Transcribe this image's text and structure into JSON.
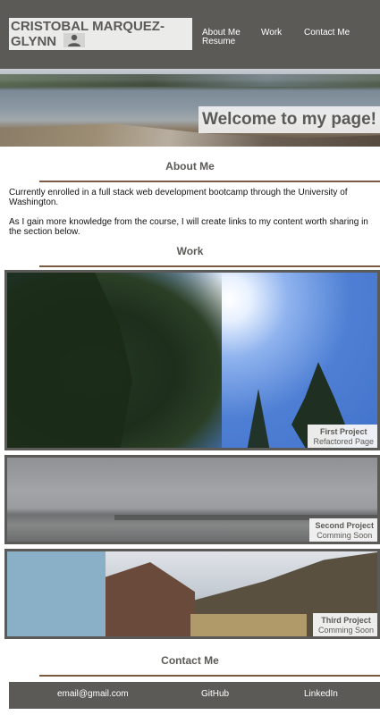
{
  "header": {
    "name": "CRISTOBAL MARQUEZ-GLYNN",
    "avatar_icon": "user-icon",
    "nav": {
      "about": "About Me",
      "resume": "Resume",
      "work": "Work",
      "contact": "Contact Me"
    }
  },
  "hero": {
    "title": "Welcome to my page!"
  },
  "about": {
    "heading": "About Me",
    "paragraphs": [
      "Currently enrolled in a full stack web development bootcamp through the University of Washington.",
      "As I gain more knowledge from the course, I will create links to my content worth sharing in the section below."
    ]
  },
  "work": {
    "heading": "Work",
    "projects": [
      {
        "title": "First Project",
        "subtitle": "Refactored Page"
      },
      {
        "title": "Second Project",
        "subtitle": "Comming Soon"
      },
      {
        "title": "Third Project",
        "subtitle": "Comming Soon"
      }
    ]
  },
  "contact": {
    "heading": "Contact Me",
    "links": {
      "email": "email@gmail.com",
      "github": "GitHub",
      "linkedin": "LinkedIn"
    }
  },
  "colors": {
    "primary": "#5b5a56",
    "accent_rule": "#7a5a43"
  }
}
